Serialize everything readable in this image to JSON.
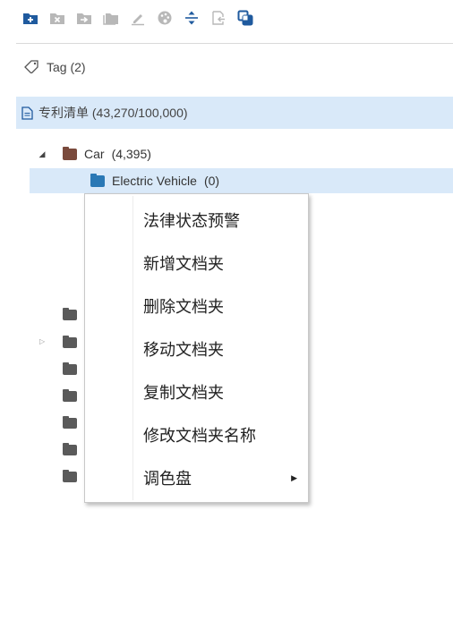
{
  "toolbar": {
    "icons": [
      {
        "name": "add-folder-icon",
        "color": "#1f5a9e"
      },
      {
        "name": "delete-folder-icon",
        "color": "#b8b8b8"
      },
      {
        "name": "move-folder-icon",
        "color": "#b8b8b8"
      },
      {
        "name": "copy-folder-icon",
        "color": "#b8b8b8"
      },
      {
        "name": "rename-icon",
        "color": "#b8b8b8"
      },
      {
        "name": "palette-icon",
        "color": "#b8b8b8"
      },
      {
        "name": "expand-collapse-icon",
        "color": "#1f5a9e"
      },
      {
        "name": "export-icon",
        "color": "#b8b8b8"
      },
      {
        "name": "merge-icon",
        "color": "#1f5a9e"
      }
    ]
  },
  "tag": {
    "icon": "tag-icon",
    "label": "Tag (2)"
  },
  "patent_list": {
    "icon": "document-icon",
    "label": "专利清单 (43,270/100,000)"
  },
  "tree": {
    "car": {
      "label": "Car",
      "count": "(4,395)",
      "expanded": true,
      "color": "#7a4a3c"
    },
    "electric_vehicle": {
      "label": "Electric Vehicle",
      "count": "(0)",
      "color": "#2a78b5"
    }
  },
  "context_menu": {
    "items": [
      {
        "label": "法律状态预警",
        "has_submenu": false
      },
      {
        "label": "新增文档夹",
        "has_submenu": false
      },
      {
        "label": "删除文档夹",
        "has_submenu": false
      },
      {
        "label": "移动文档夹",
        "has_submenu": false
      },
      {
        "label": "复制文档夹",
        "has_submenu": false
      },
      {
        "label": "修改文档夹名称",
        "has_submenu": false
      },
      {
        "label": "调色盘",
        "has_submenu": true
      }
    ]
  },
  "colors": {
    "selection": "#d9e9f9",
    "accent": "#1f5a9e",
    "disabled_icon": "#b8b8b8"
  }
}
